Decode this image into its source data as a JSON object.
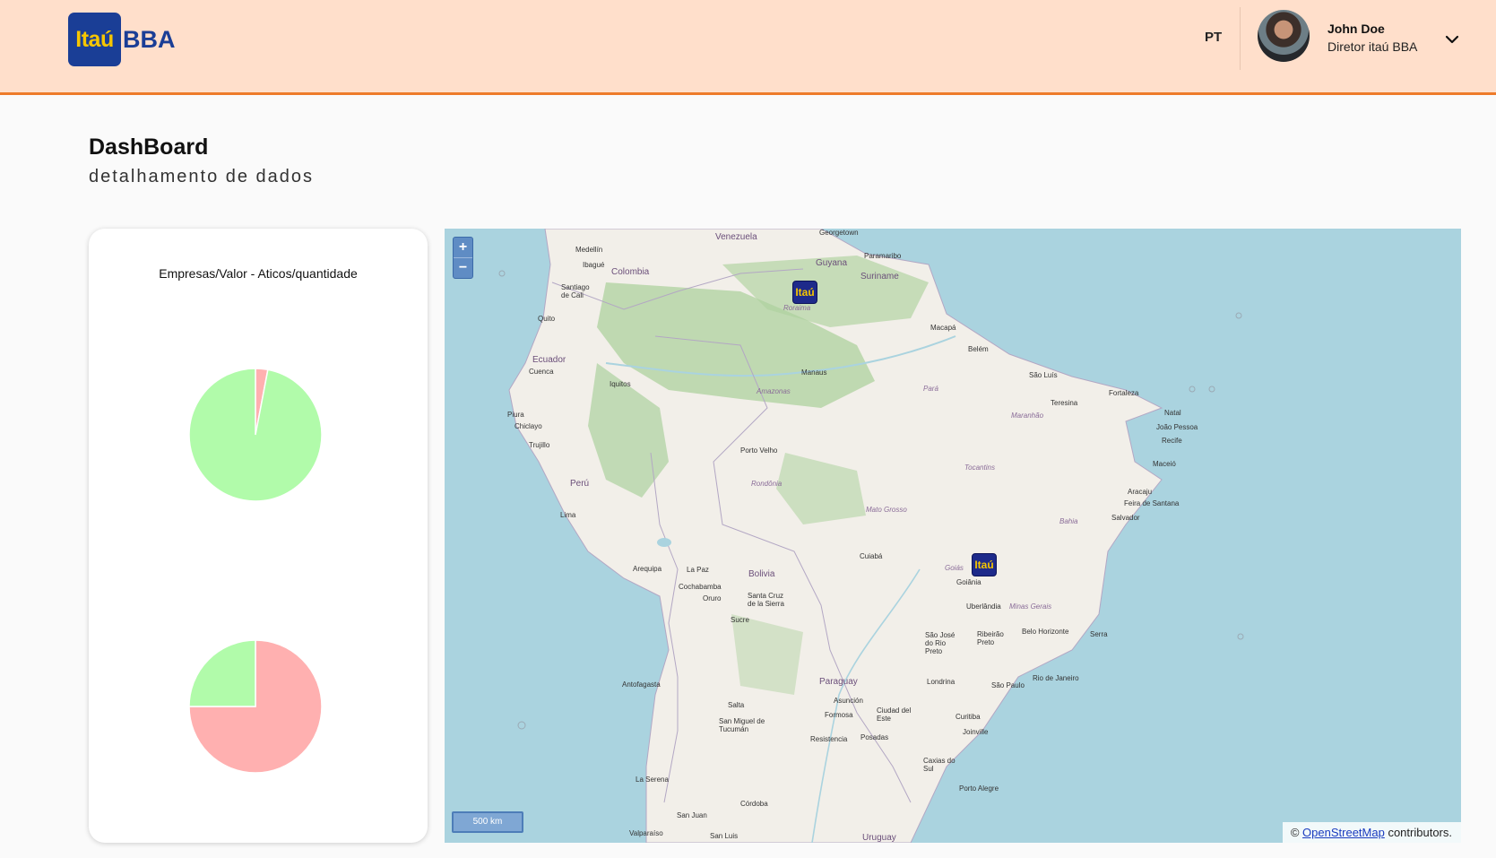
{
  "header": {
    "logo": {
      "box_text": "Itaú",
      "text": "BBA"
    },
    "language": "PT",
    "user": {
      "name": "John Doe",
      "role": "Diretor itaú BBA"
    },
    "colors": {
      "background": "#ffdfcb",
      "accent": "#ee7b2a",
      "brand": "#1a3e96"
    }
  },
  "page": {
    "title": "DashBoard",
    "subtitle": "detalhamento de dados"
  },
  "chart_card": {
    "title": "Empresas/Valor - Aticos/quantidade"
  },
  "chart_data": [
    {
      "type": "pie",
      "slices": [
        {
          "share": 0.03,
          "color": "#ffb0b0"
        },
        {
          "share": 0.97,
          "color": "#b1fbaa"
        }
      ]
    },
    {
      "type": "pie",
      "slices": [
        {
          "share": 0.75,
          "color": "#ffb0b0"
        },
        {
          "share": 0.25,
          "color": "#b1fbaa"
        }
      ]
    }
  ],
  "map": {
    "zoom_in": "+",
    "zoom_out": "−",
    "scale": "500 km",
    "attribution_prefix": "©",
    "attribution_link": "OpenStreetMap",
    "attribution_suffix": "contributors.",
    "markers": [
      {
        "label": "Itaú",
        "place": "Roraima"
      },
      {
        "label": "Itaú",
        "place": "Goiânia"
      }
    ],
    "labels": {
      "venezuela": "Venezuela",
      "guyana": "Guyana",
      "suriname": "Suriname",
      "colombia": "Colombia",
      "ecuador": "Ecuador",
      "peru": "Perú",
      "bolivia": "Bolivia",
      "paraguay": "Paraguay",
      "uruguay": "Uruguay",
      "medellin": "Medellín",
      "ibague": "Ibagué",
      "cali": "Santiago de Cali",
      "quito": "Quito",
      "cuenca": "Cuenca",
      "piura": "Piura",
      "chiclayo": "Chiclayo",
      "trujillo": "Trujillo",
      "lima": "Lima",
      "iquitos": "Iquitos",
      "arequipa": "Arequipa",
      "lapaz": "La Paz",
      "cochabamba": "Cochabamba",
      "oruro": "Oruro",
      "sucre": "Sucre",
      "santacruz": "Santa Cruz de la Sierra",
      "antofagasta": "Antofagasta",
      "salta": "Salta",
      "tucuman": "San Miguel de Tucumán",
      "laserena": "La Serena",
      "cordoba": "Córdoba",
      "sanjuan": "San Juan",
      "sanluis": "San Luis",
      "valparaiso": "Valparaíso",
      "manaus": "Manaus",
      "macapa": "Macapá",
      "belem": "Belém",
      "saoluis": "São Luís",
      "fortaleza": "Fortaleza",
      "teresina": "Teresina",
      "natal": "Natal",
      "joaopessoa": "João Pessoa",
      "recife": "Recife",
      "maceio": "Maceió",
      "aracaju": "Aracaju",
      "feira": "Feira de Santana",
      "salvador": "Salvador",
      "portovelho": "Porto Velho",
      "cuiaba": "Cuiabá",
      "goiania": "Goiânia",
      "uberlandia": "Uberlândia",
      "riopreto": "São José do Rio Preto",
      "ribeirao": "Ribeirão Preto",
      "bh": "Belo Horizonte",
      "serra": "Serra",
      "saopaulo": "São Paulo",
      "rio": "Rio de Janeiro",
      "londrina": "Londrina",
      "curitiba": "Curitiba",
      "joinville": "Joinville",
      "caxias": "Caxias do Sul",
      "portoalegre": "Porto Alegre",
      "asuncion": "Asunción",
      "formosa": "Formosa",
      "resistencia": "Resistencia",
      "posadas": "Posadas",
      "ciudaddeleste": "Ciudad del Este",
      "georgetown": "Georgetown",
      "paramaribo": "Paramaribo",
      "amazonas": "Amazonas",
      "para": "Pará",
      "maranhao": "Maranhão",
      "rondonia": "Rondônia",
      "matogrosso": "Mato Grosso",
      "goias": "Goiás",
      "minas": "Minas Gerais",
      "bahia": "Bahia",
      "tocantins": "Tocantins",
      "roraima": "Roraima"
    }
  }
}
